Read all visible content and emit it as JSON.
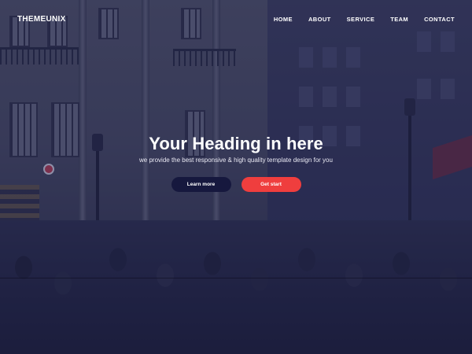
{
  "brand": {
    "logo_text": "THEMEUNIX"
  },
  "nav": {
    "items": [
      {
        "label": "HOME"
      },
      {
        "label": "ABOUT"
      },
      {
        "label": "SERVICE"
      },
      {
        "label": "TEAM"
      },
      {
        "label": "CONTACT"
      }
    ]
  },
  "hero": {
    "heading": "Your Heading in here",
    "subheading": "we provide the best responsive & high quality template design for you",
    "buttons": {
      "learn_more": "Learn more",
      "get_start": "Get start"
    },
    "background_image": "city-street-crowd-photo"
  },
  "colors": {
    "overlay": "#222452",
    "button_dark": "#16183e",
    "button_accent": "#ef3e3e",
    "text": "#ffffff"
  }
}
